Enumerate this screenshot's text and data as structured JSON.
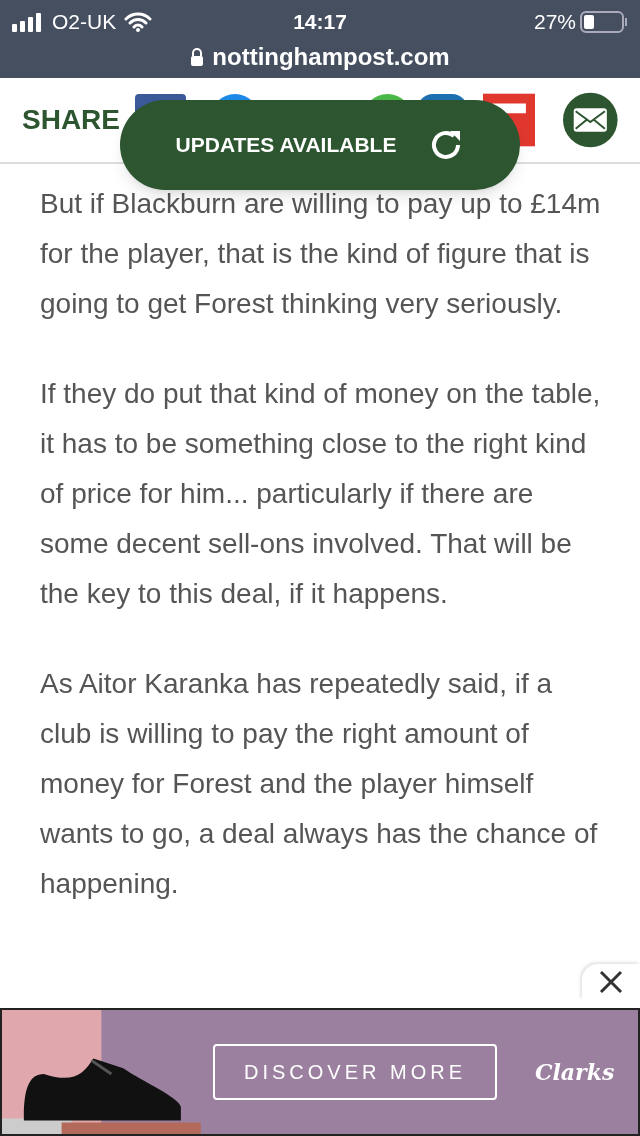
{
  "status_bar": {
    "carrier": "O2-UK",
    "time": "14:17",
    "battery": "27%",
    "url": "nottinghampost.com"
  },
  "share_bar": {
    "label": "SHARE"
  },
  "toast": {
    "label": "UPDATES AVAILABLE"
  },
  "article": {
    "paragraphs": [
      "But if Blackburn are willing to pay up to £14m for the player, that is the kind of figure that is going to get Forest thinking very seriously.",
      "If they do put that kind of money on the table, it has to be something close to the right kind of price for him... particularly if there are some decent sell-ons involved. That will be the key to this deal, if it happens.",
      "As Aitor Karanka has repeatedly said, if a club is willing to pay the right amount of money for Forest and the player himself wants to go, a deal always has the chance of happening."
    ]
  },
  "ad": {
    "kind": "picture",
    "button": "DISCOVER MORE",
    "logo": "Clarks"
  }
}
